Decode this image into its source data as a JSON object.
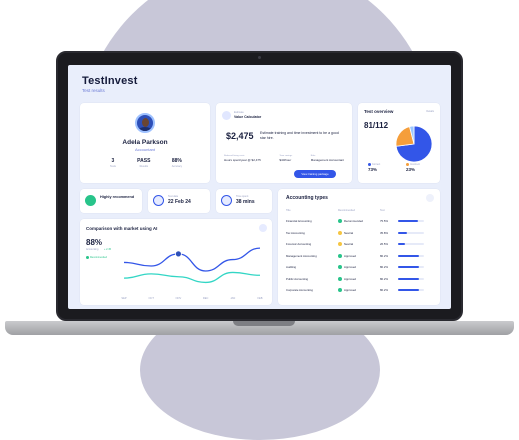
{
  "app": {
    "brand": "TestInvest",
    "subtitle": "Test results"
  },
  "profile": {
    "name": "Adela Parkson",
    "role": "Accountant",
    "stats": [
      {
        "value": "3",
        "label": "Tests"
      },
      {
        "value": "PASS",
        "label": "Results"
      },
      {
        "value": "88%",
        "label": "Accuracy"
      }
    ]
  },
  "value_calculator": {
    "small_label": "Estimate",
    "title": "Value Calculator",
    "amount": "$2,475",
    "description": "Estimate training and time investment to be a good star hire.",
    "fields": [
      {
        "label": "Reduced hiring costs",
        "value": "Hours spent/year @ $2,475"
      },
      {
        "label": "Time savings",
        "value": "$40/hour"
      },
      {
        "label": "Role",
        "value": "Management Accountant"
      }
    ],
    "button_label": "View training package"
  },
  "overview": {
    "title": "Test overview",
    "link": "Details",
    "score": "81/112",
    "legend": [
      {
        "label": "Correct",
        "value": "73%",
        "color": "#3356e8"
      },
      {
        "label": "Incorrect",
        "value": "23%",
        "color": "#f59e3b"
      }
    ],
    "slices": [
      {
        "value": 73,
        "color": "#3356e8"
      },
      {
        "value": 23,
        "color": "#f59e3b"
      },
      {
        "value": 4,
        "color": "#9cc7ff"
      }
    ]
  },
  "mini_cards": [
    {
      "label": "",
      "value": "Highly recommend",
      "icon": "thumbs-up-icon",
      "color": "#28c48a"
    },
    {
      "label": "Test date",
      "value": "22 Feb 24",
      "icon": "calendar-icon",
      "color": "#3356e8"
    },
    {
      "label": "Time spent",
      "value": "38 mins",
      "icon": "clock-icon",
      "color": "#3356e8"
    }
  ],
  "comparison": {
    "title": "Comparison with market using AI",
    "percent": "88%",
    "sublabel": "Accounting",
    "gain": "+ 2.45",
    "legend": "Recommended"
  },
  "chart_data": {
    "type": "line",
    "x": [
      "SEP",
      "OCT",
      "NOV",
      "DEC",
      "JAN",
      "FEB"
    ],
    "series": [
      {
        "values": [
          40,
          35,
          52,
          28,
          44,
          60
        ],
        "color": "#3356e8"
      },
      {
        "values": [
          18,
          24,
          20,
          12,
          26,
          22
        ],
        "color": "#33d6c5"
      }
    ],
    "ylim": [
      0,
      70
    ]
  },
  "accounting": {
    "title": "Accounting types",
    "headers": [
      "Title",
      "Recommended",
      "Test",
      ""
    ],
    "rows": [
      {
        "title": "Financial Accounting",
        "status": "Recommended",
        "status_color": "#28c48a",
        "score": "75.5%",
        "progress": 0.75
      },
      {
        "title": "Tax Accounting",
        "status": "Neutral",
        "status_color": "#f5c542",
        "score": "35.8%",
        "progress": 0.36
      },
      {
        "title": "Forensic Accounting",
        "status": "Neutral",
        "status_color": "#f5c542",
        "score": "26.5%",
        "progress": 0.27
      },
      {
        "title": "Management Accounting",
        "status": "Approved",
        "status_color": "#28c48a",
        "score": "80.2%",
        "progress": 0.8
      },
      {
        "title": "Auditing",
        "status": "Approved",
        "status_color": "#28c48a",
        "score": "80.2%",
        "progress": 0.8
      },
      {
        "title": "Public Accounting",
        "status": "Approved",
        "status_color": "#28c48a",
        "score": "80.2%",
        "progress": 0.8
      },
      {
        "title": "Corporate Accounting",
        "status": "Approved",
        "status_color": "#28c48a",
        "score": "80.2%",
        "progress": 0.8
      }
    ]
  }
}
